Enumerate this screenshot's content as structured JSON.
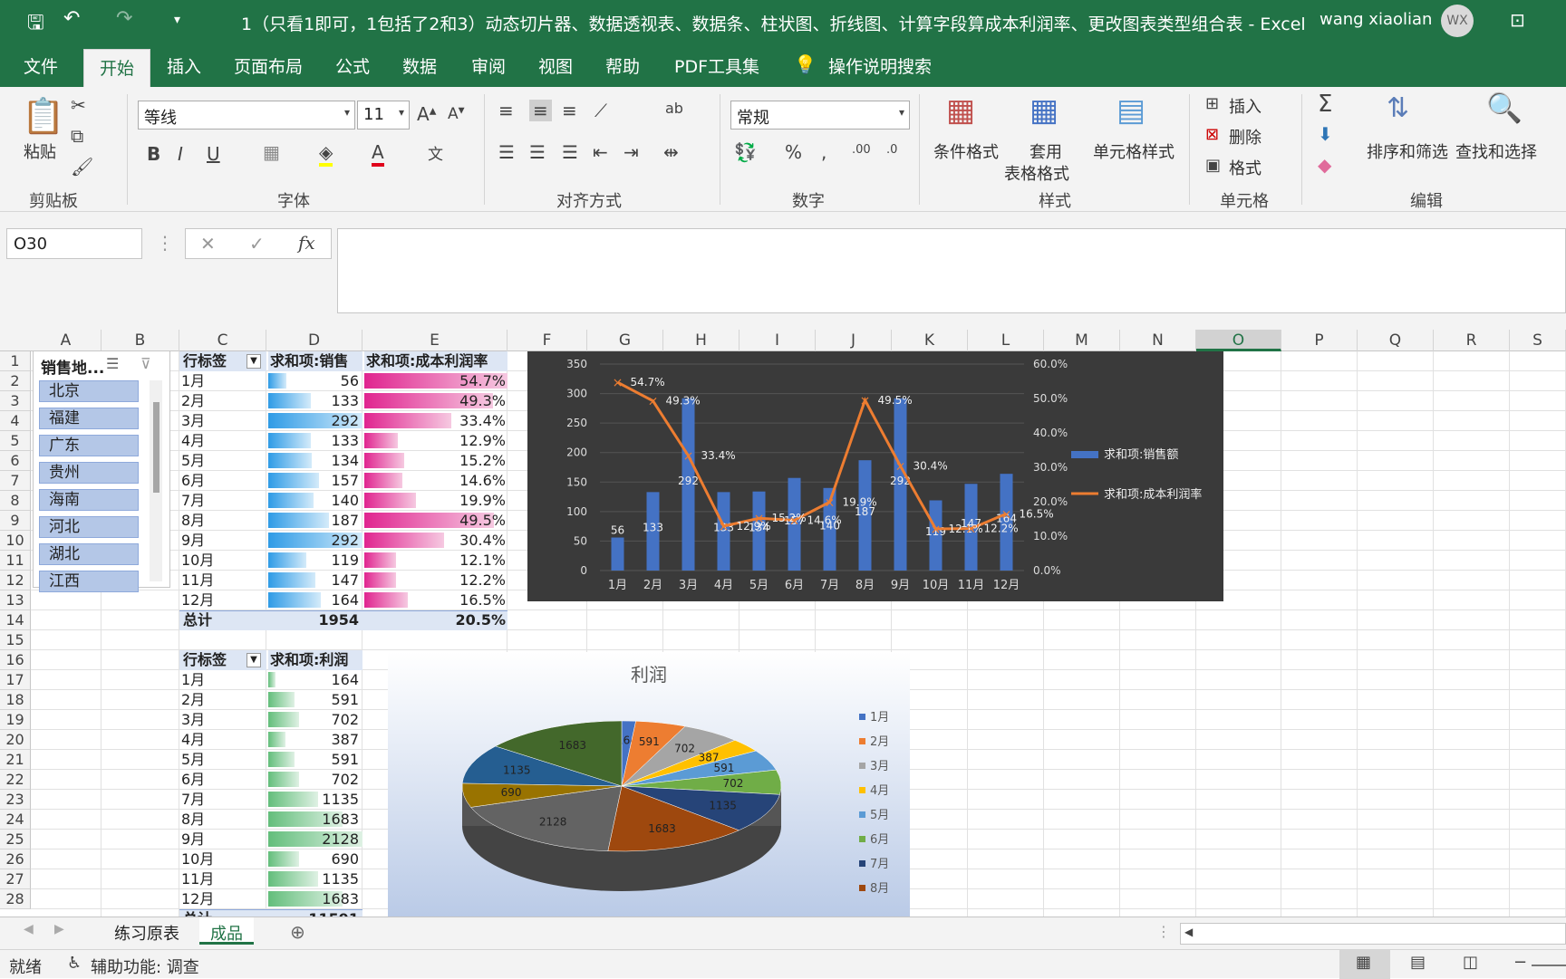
{
  "title": "1（只看1即可，1包括了2和3）动态切片器、数据透视表、数据条、柱状图、折线图、计算字段算成本利润率、更改图表类型组合表  -  Excel",
  "user": {
    "name": "wang xiaolian",
    "initials": "WX"
  },
  "tabs": [
    "文件",
    "开始",
    "插入",
    "页面布局",
    "公式",
    "数据",
    "审阅",
    "视图",
    "帮助",
    "PDF工具集",
    "操作说明搜索"
  ],
  "ribbon": {
    "paste": "粘贴",
    "font_name": "等线",
    "font_size": "11",
    "number_format": "常规",
    "cond_format": "条件格式",
    "table_format": [
      "套用",
      "表格格式"
    ],
    "cell_style": "单元格样式",
    "insert": "插入",
    "delete": "删除",
    "format": "格式",
    "sort_filter": "排序和筛选",
    "find_select": "查找和选择",
    "groups": [
      "剪贴板",
      "字体",
      "对齐方式",
      "数字",
      "样式",
      "单元格",
      "编辑"
    ]
  },
  "namebox": "O30",
  "columns": [
    "A",
    "B",
    "C",
    "D",
    "E",
    "F",
    "G",
    "H",
    "I",
    "J",
    "K",
    "L",
    "M",
    "N",
    "O",
    "P",
    "Q",
    "R",
    "S"
  ],
  "rows": [
    "1",
    "2",
    "3",
    "4",
    "5",
    "6",
    "7",
    "8",
    "9",
    "10",
    "11",
    "12",
    "13",
    "14",
    "15",
    "16",
    "17",
    "18",
    "19",
    "20",
    "21",
    "22",
    "23",
    "24",
    "25",
    "26",
    "27",
    "28"
  ],
  "slicer": {
    "header": "销售地...",
    "items": [
      "北京",
      "福建",
      "广东",
      "贵州",
      "海南",
      "河北",
      "湖北",
      "江西"
    ]
  },
  "pivot1": {
    "headers": [
      "行标签",
      "求和项:销售",
      "求和项:成本利润率"
    ],
    "rows": [
      [
        "1月",
        "56",
        "54.7%"
      ],
      [
        "2月",
        "133",
        "49.3%"
      ],
      [
        "3月",
        "292",
        "33.4%"
      ],
      [
        "4月",
        "133",
        "12.9%"
      ],
      [
        "5月",
        "134",
        "15.2%"
      ],
      [
        "6月",
        "157",
        "14.6%"
      ],
      [
        "7月",
        "140",
        "19.9%"
      ],
      [
        "8月",
        "187",
        "49.5%"
      ],
      [
        "9月",
        "292",
        "30.4%"
      ],
      [
        "10月",
        "119",
        "12.1%"
      ],
      [
        "11月",
        "147",
        "12.2%"
      ],
      [
        "12月",
        "164",
        "16.5%"
      ]
    ],
    "total": [
      "总计",
      "1954",
      "20.5%"
    ]
  },
  "pivot2": {
    "headers": [
      "行标签",
      "求和项:利润"
    ],
    "rows": [
      [
        "1月",
        "164"
      ],
      [
        "2月",
        "591"
      ],
      [
        "3月",
        "702"
      ],
      [
        "4月",
        "387"
      ],
      [
        "5月",
        "591"
      ],
      [
        "6月",
        "702"
      ],
      [
        "7月",
        "1135"
      ],
      [
        "8月",
        "1683"
      ],
      [
        "9月",
        "2128"
      ],
      [
        "10月",
        "690"
      ],
      [
        "11月",
        "1135"
      ],
      [
        "12月",
        "1683"
      ]
    ],
    "total_partial": [
      "总计",
      "11591"
    ]
  },
  "chart_data": [
    {
      "type": "bar",
      "categories": [
        "1月",
        "2月",
        "3月",
        "4月",
        "5月",
        "6月",
        "7月",
        "8月",
        "9月",
        "10月",
        "11月",
        "12月"
      ],
      "series": [
        {
          "name": "求和项:销售额",
          "type": "bar",
          "axis": "left",
          "values": [
            56,
            133,
            292,
            133,
            134,
            157,
            140,
            187,
            292,
            119,
            147,
            164
          ]
        },
        {
          "name": "求和项:成本利润率",
          "type": "line",
          "axis": "right",
          "values": [
            54.7,
            49.3,
            33.4,
            12.9,
            15.2,
            14.6,
            19.9,
            49.5,
            30.4,
            12.1,
            12.2,
            16.5
          ]
        }
      ],
      "ylim": [
        0,
        350
      ],
      "y2lim": [
        0,
        60
      ],
      "yticks": [
        "0",
        "50",
        "100",
        "150",
        "200",
        "250",
        "300",
        "350"
      ],
      "y2ticks": [
        "0.0%",
        "10.0%",
        "20.0%",
        "30.0%",
        "40.0%",
        "50.0%",
        "60.0%"
      ],
      "legend": "right"
    },
    {
      "type": "pie",
      "title": "利润",
      "categories": [
        "1月",
        "2月",
        "3月",
        "4月",
        "5月",
        "6月",
        "7月",
        "8月",
        "9月",
        "10月",
        "11月",
        "12月"
      ],
      "values": [
        164,
        591,
        702,
        387,
        591,
        702,
        1135,
        1683,
        2128,
        690,
        1135,
        1683
      ],
      "legend": "right",
      "legend_visible": [
        "1月",
        "2月",
        "3月",
        "4月",
        "5月",
        "6月",
        "7月",
        "8月"
      ]
    }
  ],
  "sheet_tabs": [
    "练习原表",
    "成品"
  ],
  "status": {
    "ready": "就绪",
    "accessibility": "辅助功能: 调查"
  },
  "colors": {
    "excel_green": "#217346",
    "bar_blue": "#4472c4",
    "line_orange": "#ed7d31",
    "databar_blue": "#2e9be6",
    "databar_pink": "#e0248f",
    "databar_green": "#63be7b"
  }
}
